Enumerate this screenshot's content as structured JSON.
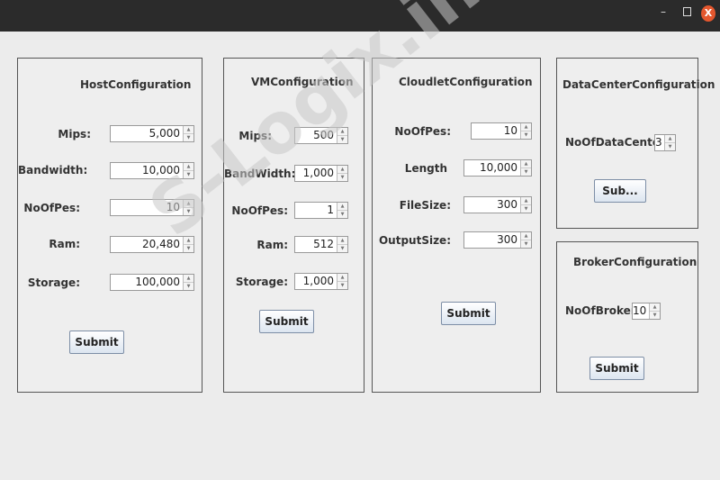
{
  "window": {
    "minimize": "–",
    "close": "X"
  },
  "host": {
    "title": "HostConfiguration",
    "mips_label": "Mips:",
    "mips": "5,000",
    "bandwidth_label": "Bandwidth:",
    "bandwidth": "10,000",
    "pes_label": "NoOfPes:",
    "pes": "10",
    "ram_label": "Ram:",
    "ram": "20,480",
    "storage_label": "Storage:",
    "storage": "100,000",
    "submit": "Submit"
  },
  "vm": {
    "title": "VMConfiguration",
    "mips_label": "Mips:",
    "mips": "500",
    "bandwidth_label": "BandWidth:",
    "bandwidth": "1,000",
    "pes_label": "NoOfPes:",
    "pes": "1",
    "ram_label": "Ram:",
    "ram": "512",
    "size_label": "Storage:",
    "size": "1,000",
    "submit": "Submit"
  },
  "cloudlet": {
    "title": "CloudletConfiguration",
    "pes_label": "NoOfPes:",
    "pes": "10",
    "length_label": "Length",
    "length": "10,000",
    "filesize_label": "FileSize:",
    "filesize": "300",
    "outputsize_label": "OutputSize:",
    "outputsize": "300",
    "submit": "Submit"
  },
  "datacenter": {
    "title": "DataCenterConfiguration",
    "count_label": "NoOfDataCenter",
    "count": "3",
    "submit": "Sub..."
  },
  "broker": {
    "title": "BrokerConfiguration",
    "count_label": "NoOfBroker",
    "count": "10",
    "submit": "Submit"
  },
  "watermark": "S-Logix.in"
}
